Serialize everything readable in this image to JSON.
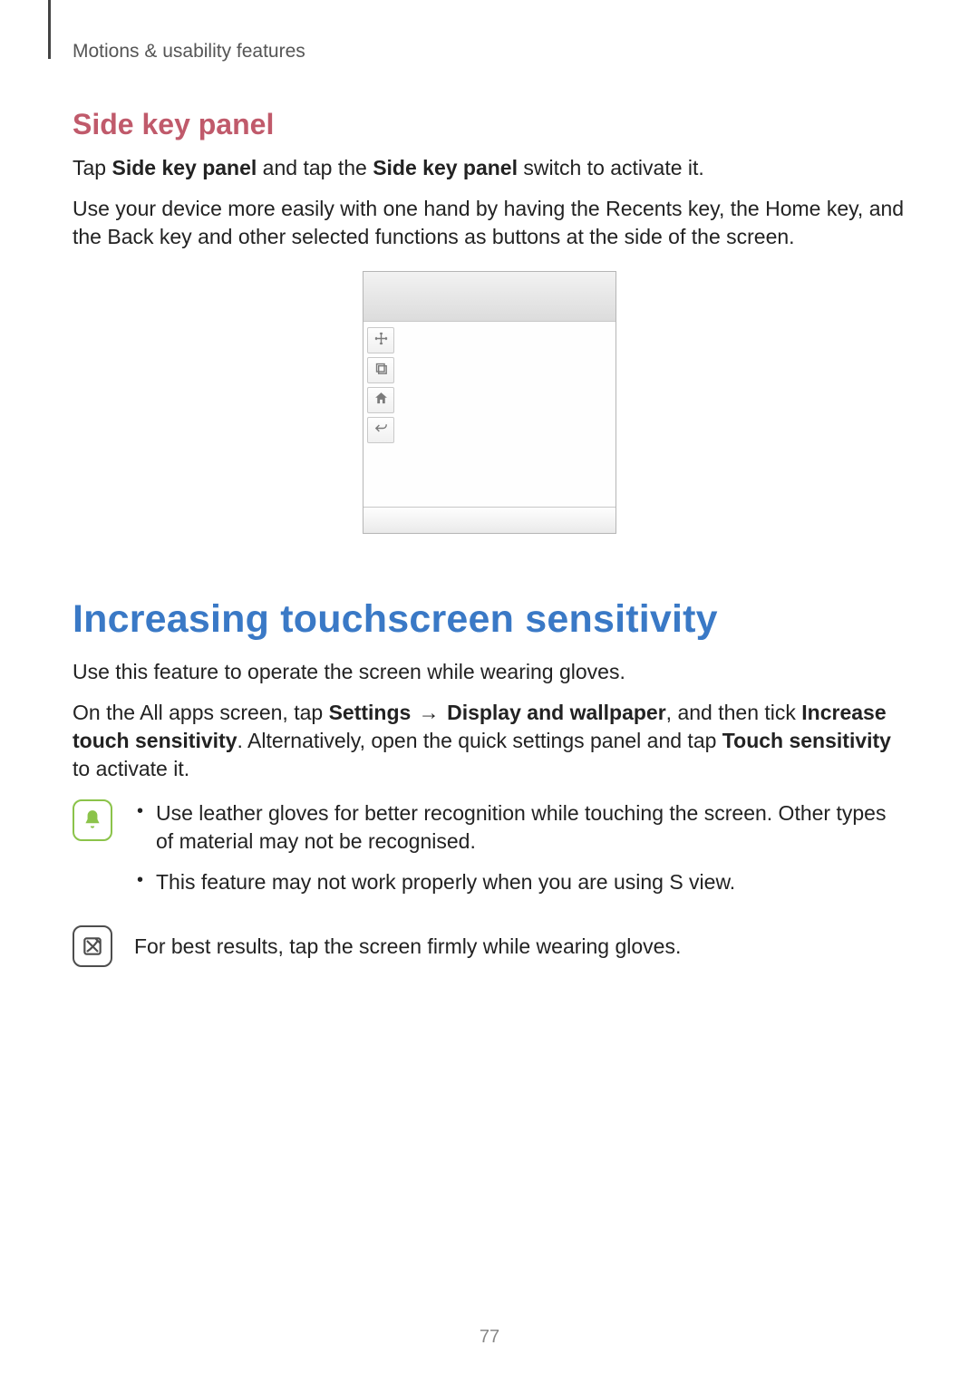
{
  "header": {
    "breadcrumb": "Motions & usability features"
  },
  "side_key": {
    "title": "Side key panel",
    "p1": {
      "pre": "Tap ",
      "b1": "Side key panel",
      "mid": " and tap the ",
      "b2": "Side key panel",
      "post": " switch to activate it."
    },
    "p2": "Use your device more easily with one hand by having the Recents key, the Home key, and the Back key and other selected functions as buttons at the side of the screen."
  },
  "mock": {
    "icons": {
      "move": "move-icon",
      "recents": "recents-icon",
      "home": "home-icon",
      "back": "back-icon"
    }
  },
  "touch": {
    "title": "Increasing touchscreen sensitivity",
    "p1": "Use this feature to operate the screen while wearing gloves.",
    "p2": {
      "t1": "On the All apps screen, tap ",
      "b1": "Settings",
      "arrow": " → ",
      "b2": "Display and wallpaper",
      "t2": ", and then tick ",
      "b3": "Increase touch sensitivity",
      "t3": ". Alternatively, open the quick settings panel and tap ",
      "b4": "Touch sensitivity",
      "t4": " to activate it."
    },
    "warn": {
      "item1": "Use leather gloves for better recognition while touching the screen. Other types of material may not be recognised.",
      "item2": "This feature may not work properly when you are using S view."
    },
    "tip": "For best results, tap the screen firmly while wearing gloves."
  },
  "page_number": "77"
}
